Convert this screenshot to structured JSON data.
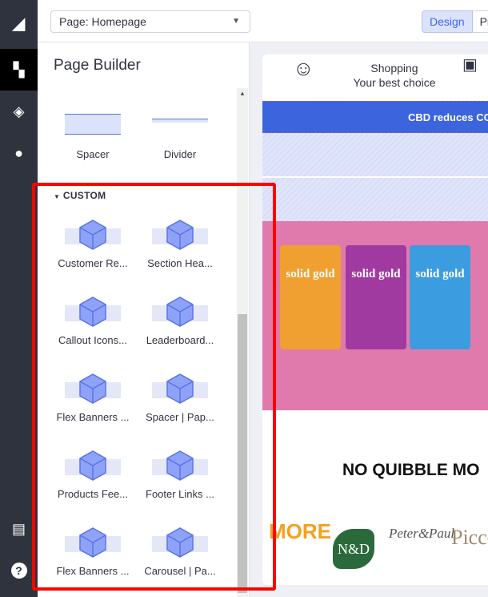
{
  "rail": {
    "items": [
      {
        "icon": "bigcommerce-logo-icon"
      },
      {
        "icon": "page-builder-icon",
        "active": true
      },
      {
        "icon": "layers-icon"
      },
      {
        "icon": "theme-palette-icon"
      },
      {
        "icon": "storefront-icon"
      },
      {
        "icon": "help-icon"
      }
    ]
  },
  "topbar": {
    "page_select": "Page: Homepage",
    "design_label": "Design",
    "preview_label": "Pre"
  },
  "panel": {
    "title": "Page Builder",
    "layout_items": [
      {
        "label": "Spacer"
      },
      {
        "label": "Divider"
      }
    ],
    "custom_section": "CUSTOM",
    "custom_items": [
      {
        "label": "Customer Re..."
      },
      {
        "label": "Section Hea..."
      },
      {
        "label": "Callout Icons..."
      },
      {
        "label": "Leaderboard..."
      },
      {
        "label": "Flex Banners ..."
      },
      {
        "label": "Spacer | Pap..."
      },
      {
        "label": "Products Fee..."
      },
      {
        "label": "Footer Links ..."
      },
      {
        "label": "Flex Banners ..."
      },
      {
        "label": "Carousel | Pa..."
      }
    ]
  },
  "preview": {
    "shopping": "Shopping",
    "tagline": "Your best choice",
    "banner": "CBD reduces CO",
    "brand": "solid gold",
    "heading": "NO QUIBBLE MO",
    "logos": [
      "MORE",
      "N&D",
      "Peter&Paul",
      "Piccol"
    ]
  },
  "colors": {
    "accent": "#3c64f4",
    "highlight": "#ff0000",
    "rail": "#2f333e"
  }
}
